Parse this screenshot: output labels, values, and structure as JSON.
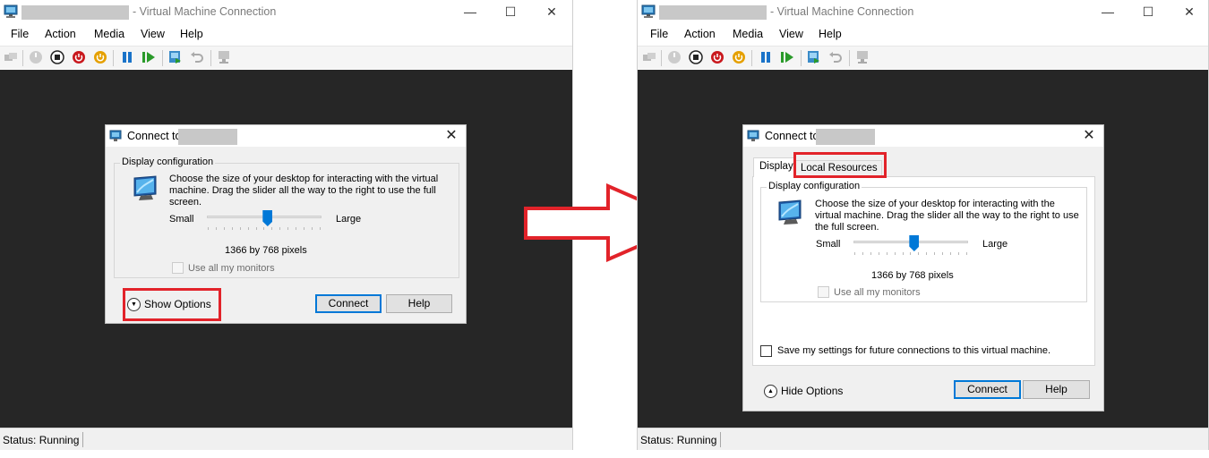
{
  "left_window": {
    "title": "- Virtual Machine Connection",
    "menu": [
      "File",
      "Action",
      "Media",
      "View",
      "Help"
    ],
    "status": "Status: Running",
    "dialog": {
      "title": "Connect to",
      "group_label": "Display configuration",
      "description": "Choose the size of your desktop for interacting with the virtual machine. Drag the slider all the way to the right to use the full screen.",
      "slider_min_label": "Small",
      "slider_max_label": "Large",
      "slider_level_fraction": 0.53,
      "resolution": "1366 by 768 pixels",
      "use_all_monitors": "Use all my monitors",
      "show_options": "Show Options",
      "connect": "Connect",
      "help": "Help"
    }
  },
  "right_window": {
    "title": "- Virtual Machine Connection",
    "menu": [
      "File",
      "Action",
      "Media",
      "View",
      "Help"
    ],
    "status": "Status: Running",
    "dialog": {
      "title": "Connect to",
      "tabs": [
        "Display",
        "Local Resources"
      ],
      "group_label": "Display configuration",
      "description": "Choose the size of your desktop for interacting with the virtual machine. Drag the slider all the way to the right to use the full screen.",
      "slider_min_label": "Small",
      "slider_max_label": "Large",
      "slider_level_fraction": 0.53,
      "resolution": "1366 by 768 pixels",
      "use_all_monitors": "Use all my monitors",
      "save_settings": "Save my settings for future connections to this virtual machine.",
      "hide_options": "Hide Options",
      "connect": "Connect",
      "help": "Help"
    }
  },
  "colors": {
    "highlight_red": "#e2232a",
    "screen": "#262626",
    "accent": "#0078d7"
  }
}
